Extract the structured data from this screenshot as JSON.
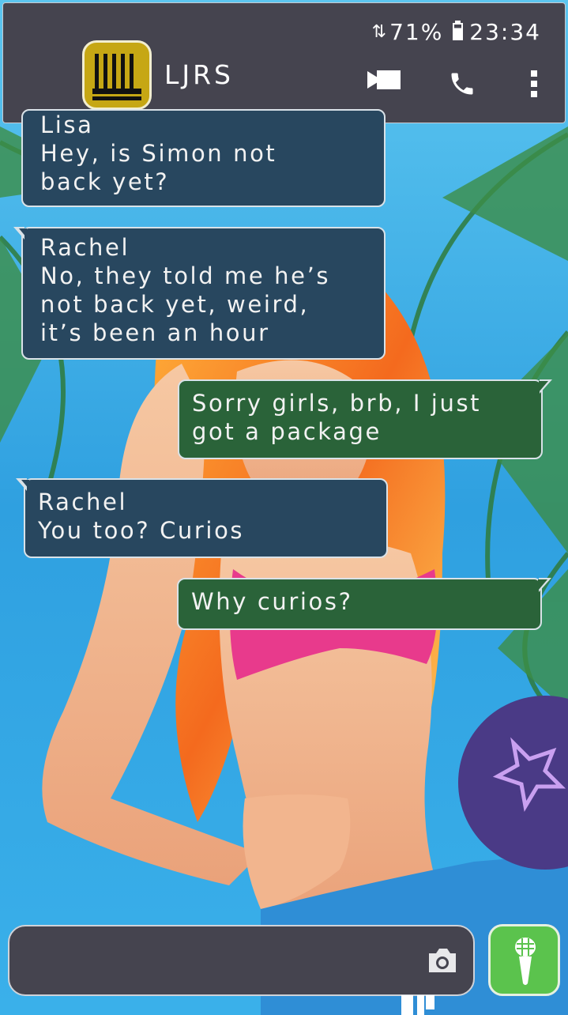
{
  "status_bar": {
    "battery": "71%",
    "time": "23:34"
  },
  "header": {
    "contact_name": "LJRS",
    "avatar_icon": "jail-bars-icon",
    "actions": [
      "video-call-icon",
      "phone-icon",
      "more-vert-icon"
    ]
  },
  "messages": [
    {
      "direction": "incoming",
      "sender": "Lisa",
      "text_lines": [
        "Hey, is Simon not",
        "back yet?"
      ]
    },
    {
      "direction": "incoming",
      "sender": "Rachel",
      "text_lines": [
        "No, they told me he’s",
        "not back yet, weird,",
        "it’s been an hour"
      ]
    },
    {
      "direction": "outgoing",
      "sender": "",
      "text_lines": [
        "Sorry girls, brb, I just",
        "got a package"
      ]
    },
    {
      "direction": "incoming",
      "sender": "Rachel",
      "text_lines": [
        "You too? Curios"
      ]
    },
    {
      "direction": "outgoing",
      "sender": "",
      "text_lines": [
        "Why curios?"
      ]
    }
  ],
  "composer": {
    "value": "",
    "camera_icon": "camera-icon",
    "mic_icon": "microphone-icon"
  },
  "colors": {
    "header_bg": "#45444f",
    "incoming_bubble": "#28475f",
    "outgoing_bubble": "#2a6339",
    "mic_button": "#5bc34d",
    "avatar_bg": "#c6a714"
  }
}
